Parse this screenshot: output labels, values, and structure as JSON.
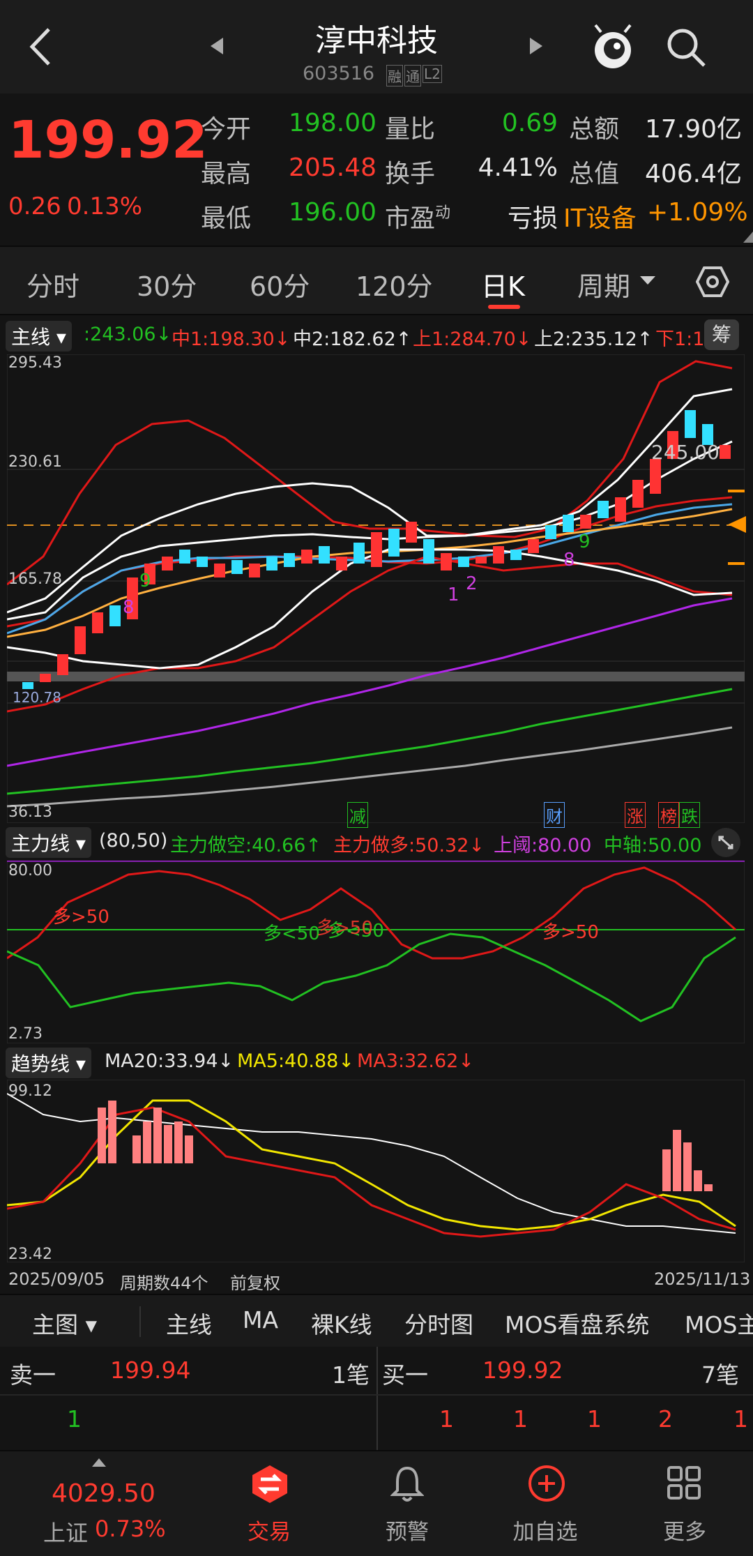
{
  "header": {
    "title": "淳中科技",
    "code": "603516",
    "badge1": "融",
    "badge2": "通",
    "badge3": "L2"
  },
  "quote": {
    "price": "199.92",
    "change": "0.26",
    "change_pct": "0.13%",
    "rows": [
      {
        "l1": "今开",
        "v1": "198.00",
        "l2": "量比",
        "v2": "0.69",
        "l3": "总额",
        "v3": "17.90亿"
      },
      {
        "l1": "最高",
        "v1": "205.48",
        "l2": "换手",
        "v2": "4.41%",
        "l3": "总值",
        "v3": "406.4亿"
      },
      {
        "l1": "最低",
        "v1": "196.00",
        "l2": "市盈",
        "l2sup": "动",
        "v2": "亏损",
        "l3": "IT设备",
        "v3": "+1.09%"
      }
    ]
  },
  "tabs": [
    "分时",
    "30分",
    "60分",
    "120分",
    "日K",
    "周期"
  ],
  "main_chart": {
    "label": "主线",
    "legend": [
      ":243.06↓",
      "中1:198.30↓",
      "中2:182.62↑",
      "上1:284.70↓",
      "上2:235.12↑",
      "下1:1"
    ],
    "chip_button": "筹",
    "axis": [
      "295.43",
      "230.61",
      "165.78",
      "36.13"
    ],
    "price_tag": "245.00",
    "left_value": "120.78",
    "markers": [
      "减",
      "财",
      "涨",
      "榜",
      "跌"
    ],
    "signals": [
      "9",
      "8",
      "9",
      "8",
      "9",
      "1",
      "2"
    ]
  },
  "force_chart": {
    "label": "主力线",
    "params": "(80,50)",
    "legend": [
      "主力做空:40.66↑",
      "主力做多:50.32↓",
      "上阈:80.00",
      "中轴:50.00"
    ],
    "axis": [
      "80.00",
      "2.73"
    ],
    "annotations": [
      "多>50",
      "多<50",
      "多<50",
      "多>50",
      "多>50"
    ]
  },
  "trend_chart": {
    "label": "趋势线",
    "legend": [
      "MA20:33.94↓",
      "MA5:40.88↓",
      "MA3:32.62↓"
    ],
    "axis": [
      "99.12",
      "23.42"
    ]
  },
  "date_bar": {
    "start": "2025/09/05",
    "periods": "周期数44个",
    "adj": "前复权",
    "end": "2025/11/13"
  },
  "bottom_bar": {
    "main": "主图",
    "items": [
      "主线",
      "MA",
      "裸K线",
      "分时图",
      "MOS看盘系统",
      "MOS主"
    ]
  },
  "order_book": {
    "sell_label": "卖一",
    "sell_price": "199.94",
    "sell_count": "1笔",
    "buy_label": "买一",
    "buy_price": "199.92",
    "buy_count": "7笔",
    "sell_detail": [
      "1"
    ],
    "buy_detail": [
      "1",
      "1",
      "1",
      "2",
      "1"
    ]
  },
  "nav": {
    "index_value": "4029.50",
    "index_name": "上证",
    "index_pct": "0.73%",
    "items": [
      "交易",
      "预警",
      "加自选",
      "更多"
    ]
  },
  "colors": {
    "red": "#ff3b30",
    "green": "#22c122",
    "orange": "#ff9500",
    "purple": "#b026e8",
    "yellow": "#f2e600"
  }
}
